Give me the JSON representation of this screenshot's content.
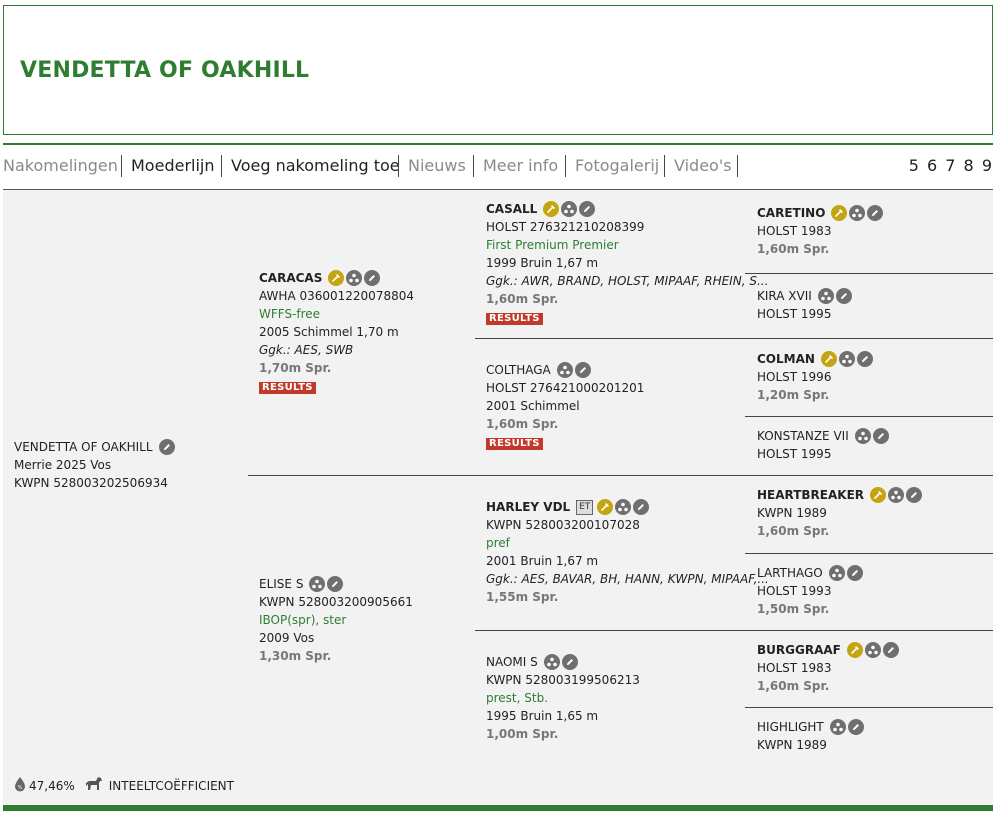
{
  "title": "VENDETTA OF OAKHILL",
  "nav": {
    "items": [
      {
        "label": "Nakomelingen",
        "state": "inactive"
      },
      {
        "label": "Moederlijn",
        "state": "active"
      },
      {
        "label": "Voeg nakomeling toe",
        "state": "active"
      },
      {
        "label": "Nieuws",
        "state": "inactive"
      },
      {
        "label": "Meer info",
        "state": "inactive"
      },
      {
        "label": "Fotogalerij",
        "state": "inactive"
      },
      {
        "label": "Video's",
        "state": "inactive"
      }
    ],
    "pages": [
      "5",
      "6",
      "7",
      "8",
      "9"
    ]
  },
  "results_label": "RESULTS",
  "et_label": "ET",
  "subject": {
    "name": "VENDETTA OF OAKHILL",
    "line1": "Merrie 2025 Vos",
    "line2": "KWPN 528003202506934",
    "icons": [
      "pencil-icon"
    ]
  },
  "sire": {
    "name": "CARACAS",
    "reg": "AWHA 036001220078804",
    "predicate": "WFFS-free",
    "info": "2005 Schimmel 1,70 m",
    "ggk": "Ggk.: AES, SWB",
    "spr": "1,70m Spr.",
    "icons": [
      "syringe-icon",
      "family-tree-icon",
      "pencil-icon"
    ]
  },
  "dam": {
    "name": "ELISE S",
    "reg": "KWPN 528003200905661",
    "predicate": "IBOP(spr), ster",
    "info": "2009 Vos",
    "spr": "1,30m Spr.",
    "icons": [
      "family-tree-icon",
      "pencil-icon"
    ]
  },
  "ss": {
    "name": "CASALL",
    "reg": "HOLST 276321210208399",
    "predicate": "First Premium Premier",
    "info": "1999 Bruin 1,67 m",
    "ggk": "Ggk.: AWR, BRAND, HOLST, MIPAAF, RHEIN, S...",
    "spr": "1,60m Spr.",
    "icons": [
      "syringe-icon",
      "family-tree-icon",
      "pencil-icon"
    ]
  },
  "sd": {
    "name": "COLTHAGA",
    "reg": "HOLST 276421000201201",
    "info": "2001 Schimmel",
    "spr": "1,60m Spr.",
    "icons": [
      "family-tree-icon",
      "pencil-icon"
    ]
  },
  "ds": {
    "name": "HARLEY VDL",
    "reg": "KWPN 528003200107028",
    "predicate": "pref",
    "info": "2001 Bruin 1,67 m",
    "ggk": "Ggk.: AES, BAVAR, BH, HANN, KWPN, MIPAAF,...",
    "spr": "1,55m Spr.",
    "icons": [
      "syringe-icon",
      "family-tree-icon",
      "pencil-icon"
    ]
  },
  "dd": {
    "name": "NAOMI S",
    "reg": "KWPN 528003199506213",
    "predicate": "prest, Stb.",
    "info": "1995 Bruin 1,65 m",
    "spr": "1,00m Spr.",
    "icons": [
      "family-tree-icon",
      "pencil-icon"
    ]
  },
  "g4": [
    {
      "name": "CARETINO",
      "bold": true,
      "reg": "HOLST 1983",
      "spr": "1,60m Spr.",
      "icons": [
        "syringe-icon",
        "family-tree-icon",
        "pencil-icon"
      ]
    },
    {
      "name": "KIRA XVII",
      "bold": false,
      "reg": "HOLST 1995",
      "spr": "",
      "icons": [
        "family-tree-icon",
        "pencil-icon"
      ]
    },
    {
      "name": "COLMAN",
      "bold": true,
      "reg": "HOLST 1996",
      "spr": "1,20m Spr.",
      "icons": [
        "syringe-icon",
        "family-tree-icon",
        "pencil-icon"
      ]
    },
    {
      "name": "KONSTANZE VII",
      "bold": false,
      "reg": "HOLST 1995",
      "spr": "",
      "icons": [
        "family-tree-icon",
        "pencil-icon"
      ]
    },
    {
      "name": "HEARTBREAKER",
      "bold": true,
      "reg": "KWPN 1989",
      "spr": "1,60m Spr.",
      "icons": [
        "syringe-icon",
        "family-tree-icon",
        "pencil-icon"
      ]
    },
    {
      "name": "LARTHAGO",
      "bold": false,
      "reg": "HOLST 1993",
      "spr": "1,50m Spr.",
      "icons": [
        "family-tree-icon",
        "pencil-icon"
      ]
    },
    {
      "name": "BURGGRAAF",
      "bold": true,
      "reg": "HOLST 1983",
      "spr": "1,60m Spr.",
      "icons": [
        "syringe-icon",
        "family-tree-icon",
        "pencil-icon"
      ]
    },
    {
      "name": "HIGHLIGHT",
      "bold": false,
      "reg": "KWPN 1989",
      "spr": "",
      "icons": [
        "family-tree-icon",
        "pencil-icon"
      ]
    }
  ],
  "footer": {
    "percentage": "47,46%",
    "label": "INTEELTCOËFFICIENT",
    "icons": [
      "blood-drop-icon",
      "horse-icon"
    ]
  },
  "colors": {
    "brand_green": "#2e7d32",
    "results_red": "#c0392b",
    "syringe_gold": "#c5a412",
    "icon_gray": "#6f6f6f",
    "panel_bg": "#f2f2f2"
  }
}
